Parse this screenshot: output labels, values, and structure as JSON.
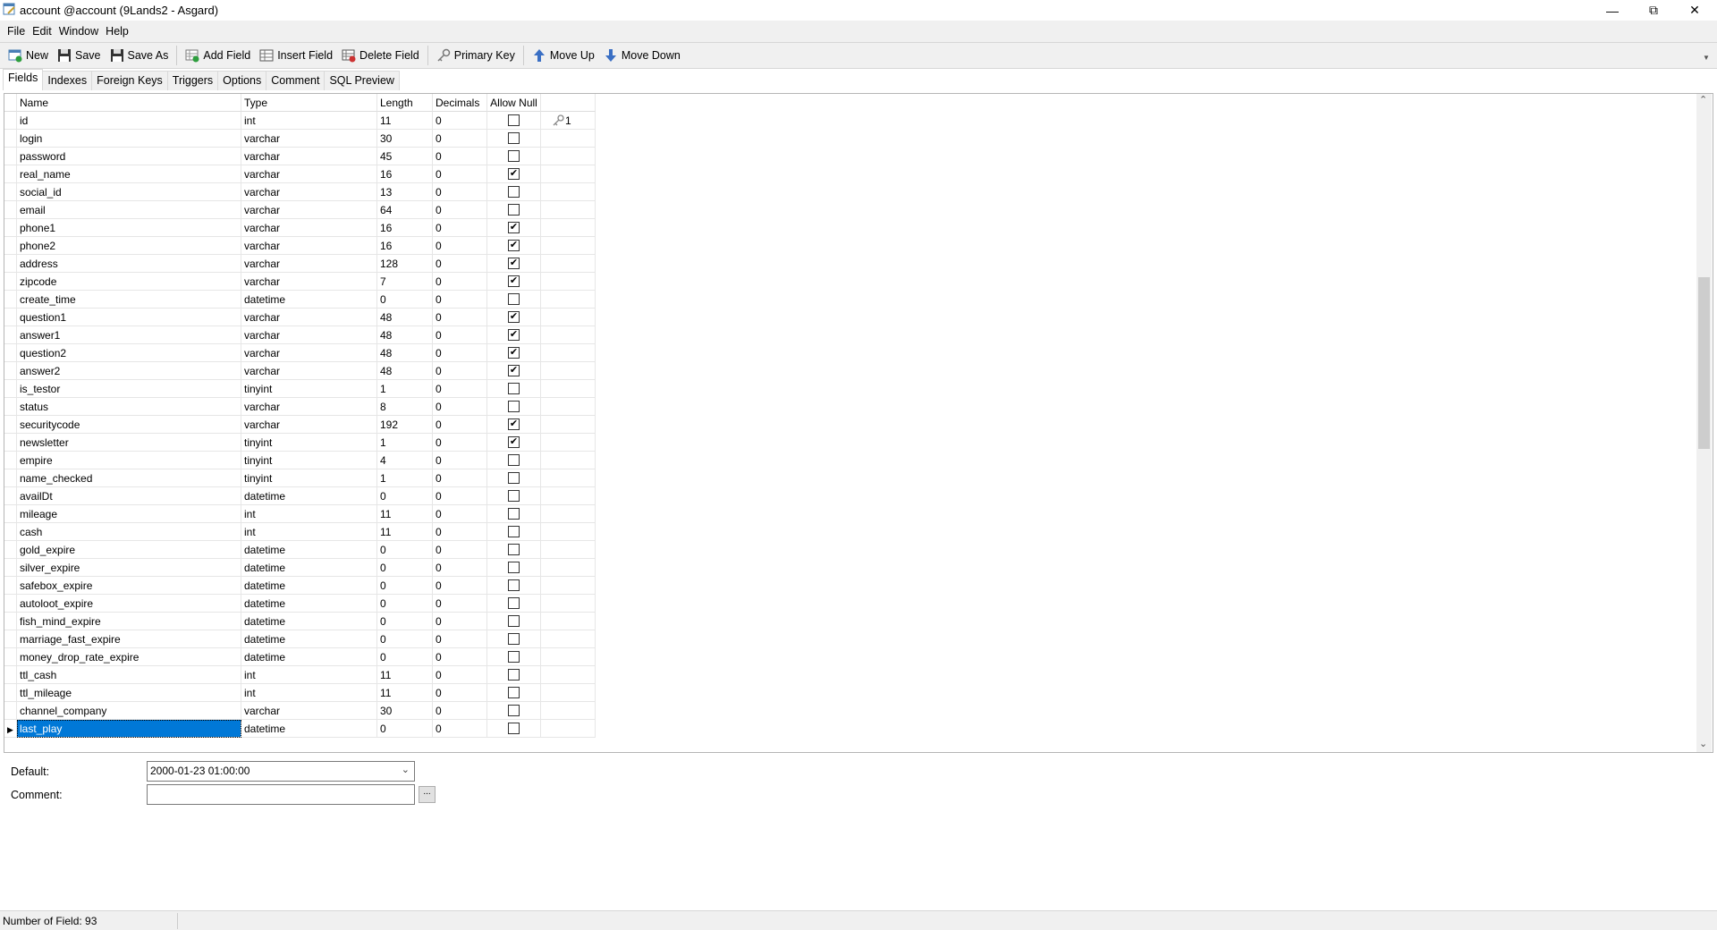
{
  "window": {
    "title": "account @account (9Lands2 - Asgard)",
    "icon": "table-design-icon",
    "controls": [
      "minimize-icon",
      "restore-icon",
      "close-icon"
    ]
  },
  "menu": [
    "File",
    "Edit",
    "Window",
    "Help"
  ],
  "toolbar": [
    {
      "label": "New",
      "icon": "new-table-icon"
    },
    {
      "label": "Save",
      "icon": "save-icon"
    },
    {
      "label": "Save As",
      "icon": "save-as-icon"
    },
    {
      "label": "Add Field",
      "icon": "add-field-icon"
    },
    {
      "label": "Insert Field",
      "icon": "insert-field-icon"
    },
    {
      "label": "Delete Field",
      "icon": "delete-field-icon"
    },
    {
      "label": "Primary Key",
      "icon": "key-icon"
    },
    {
      "label": "Move Up",
      "icon": "arrow-up-icon"
    },
    {
      "label": "Move Down",
      "icon": "arrow-down-icon"
    }
  ],
  "tabs": [
    {
      "label": "Fields",
      "active": true
    },
    {
      "label": "Indexes"
    },
    {
      "label": "Foreign Keys"
    },
    {
      "label": "Triggers"
    },
    {
      "label": "Options"
    },
    {
      "label": "Comment"
    },
    {
      "label": "SQL Preview"
    }
  ],
  "grid": {
    "columns": [
      "Name",
      "Type",
      "Length",
      "Decimals",
      "Allow Null",
      ""
    ],
    "rows": [
      [
        "id",
        "int",
        "11",
        "0",
        false,
        "1"
      ],
      [
        "login",
        "varchar",
        "30",
        "0",
        false,
        ""
      ],
      [
        "password",
        "varchar",
        "45",
        "0",
        false,
        ""
      ],
      [
        "real_name",
        "varchar",
        "16",
        "0",
        true,
        ""
      ],
      [
        "social_id",
        "varchar",
        "13",
        "0",
        false,
        ""
      ],
      [
        "email",
        "varchar",
        "64",
        "0",
        false,
        ""
      ],
      [
        "phone1",
        "varchar",
        "16",
        "0",
        true,
        ""
      ],
      [
        "phone2",
        "varchar",
        "16",
        "0",
        true,
        ""
      ],
      [
        "address",
        "varchar",
        "128",
        "0",
        true,
        ""
      ],
      [
        "zipcode",
        "varchar",
        "7",
        "0",
        true,
        ""
      ],
      [
        "create_time",
        "datetime",
        "0",
        "0",
        false,
        ""
      ],
      [
        "question1",
        "varchar",
        "48",
        "0",
        true,
        ""
      ],
      [
        "answer1",
        "varchar",
        "48",
        "0",
        true,
        ""
      ],
      [
        "question2",
        "varchar",
        "48",
        "0",
        true,
        ""
      ],
      [
        "answer2",
        "varchar",
        "48",
        "0",
        true,
        ""
      ],
      [
        "is_testor",
        "tinyint",
        "1",
        "0",
        false,
        ""
      ],
      [
        "status",
        "varchar",
        "8",
        "0",
        false,
        ""
      ],
      [
        "securitycode",
        "varchar",
        "192",
        "0",
        true,
        ""
      ],
      [
        "newsletter",
        "tinyint",
        "1",
        "0",
        true,
        ""
      ],
      [
        "empire",
        "tinyint",
        "4",
        "0",
        false,
        ""
      ],
      [
        "name_checked",
        "tinyint",
        "1",
        "0",
        false,
        ""
      ],
      [
        "availDt",
        "datetime",
        "0",
        "0",
        false,
        ""
      ],
      [
        "mileage",
        "int",
        "11",
        "0",
        false,
        ""
      ],
      [
        "cash",
        "int",
        "11",
        "0",
        false,
        ""
      ],
      [
        "gold_expire",
        "datetime",
        "0",
        "0",
        false,
        ""
      ],
      [
        "silver_expire",
        "datetime",
        "0",
        "0",
        false,
        ""
      ],
      [
        "safebox_expire",
        "datetime",
        "0",
        "0",
        false,
        ""
      ],
      [
        "autoloot_expire",
        "datetime",
        "0",
        "0",
        false,
        ""
      ],
      [
        "fish_mind_expire",
        "datetime",
        "0",
        "0",
        false,
        ""
      ],
      [
        "marriage_fast_expire",
        "datetime",
        "0",
        "0",
        false,
        ""
      ],
      [
        "money_drop_rate_expire",
        "datetime",
        "0",
        "0",
        false,
        ""
      ],
      [
        "ttl_cash",
        "int",
        "11",
        "0",
        false,
        ""
      ],
      [
        "ttl_mileage",
        "int",
        "11",
        "0",
        false,
        ""
      ],
      [
        "channel_company",
        "varchar",
        "30",
        "0",
        false,
        ""
      ],
      [
        "last_play",
        "datetime",
        "0",
        "0",
        false,
        ""
      ]
    ],
    "selected_row": "last_play",
    "selection_color": "#0078d7"
  },
  "properties": {
    "default_label": "Default:",
    "default_value": "2000-01-23 01:00:00",
    "comment_label": "Comment:",
    "comment_value": "",
    "comment_button": "..."
  },
  "status": {
    "text": "Number of Field: 93"
  }
}
